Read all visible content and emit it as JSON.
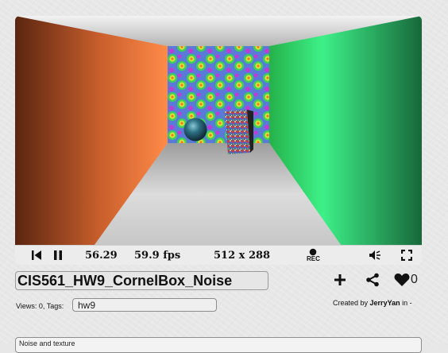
{
  "player": {
    "time": "56.29",
    "fps": "59.9 fps",
    "resolution": "512 x 288",
    "rec_label": "REC"
  },
  "shader": {
    "title": "CIS561_HW9_CornelBox_Noise",
    "views_label": "Views: 0, Tags:",
    "tags": "hw9",
    "created_by_prefix": "Created by",
    "author": "JerryYan",
    "created_suffix": "in -",
    "likes": "0",
    "description": "Noise and texture"
  },
  "icons": {
    "rewind": "skip-back-icon",
    "pause": "pause-icon",
    "rec": "record-icon",
    "volume": "volume-icon",
    "fullscreen": "fullscreen-icon",
    "add": "plus-icon",
    "share": "share-icon",
    "like": "heart-icon"
  },
  "colors": {
    "left_wall": "#e57a3e",
    "right_wall": "#2fbf5e",
    "back_wall_base": "#35c84a",
    "blob_color": "#d8e43a",
    "sphere": "#3a8a98",
    "background": "#e7e7e7"
  }
}
